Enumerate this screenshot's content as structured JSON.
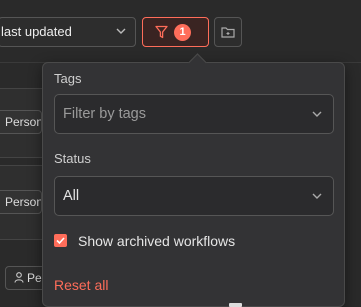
{
  "toolbar": {
    "sort_value": "last updated",
    "filter_count": "1"
  },
  "cards": [
    {
      "owner_label": "Person"
    },
    {
      "owner_label": "Person"
    }
  ],
  "bottom_chip_label": "Pe",
  "filter_popover": {
    "tags_label": "Tags",
    "tags_placeholder": "Filter by tags",
    "status_label": "Status",
    "status_value": "All",
    "show_archived_label": "Show archived workflows",
    "show_archived_checked": true,
    "reset_label": "Reset all"
  },
  "colors": {
    "accent": "#ff6d5a",
    "background": "#2a2a2a",
    "popover_bg": "#333335"
  }
}
